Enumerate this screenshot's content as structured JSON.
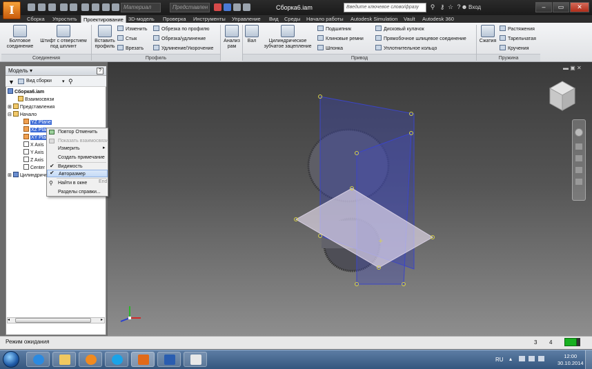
{
  "titlebar": {
    "material_combo": "Материал",
    "view_combo": "Представлен",
    "document_title": "Сборка6.iam",
    "search_placeholder": "Введите ключевое слово/фразу",
    "login_label": "Вход"
  },
  "menu_tabs": [
    {
      "label": "Сборка"
    },
    {
      "label": "Упростить"
    },
    {
      "label": "Проектирование"
    },
    {
      "label": "3D-модель"
    },
    {
      "label": "Проверка"
    },
    {
      "label": "Инструменты"
    },
    {
      "label": "Управление"
    },
    {
      "label": "Вид"
    },
    {
      "label": "Среды"
    },
    {
      "label": "Начало работы"
    },
    {
      "label": "Autodesk Simulation"
    },
    {
      "label": "Vault"
    },
    {
      "label": "Autodesk 360"
    }
  ],
  "ribbon": {
    "panels": {
      "connections": "Соединения",
      "profile": "Профиль",
      "drive": "Привод",
      "spring": "Пружина"
    },
    "bolted_connection": "Болтовое соединение",
    "pin": "Штифт с отверстием под шплинт",
    "insert_profile": "Вставить профиль",
    "change": "Изменить",
    "joint": "Стык",
    "insert": "Врезать",
    "trim_profile": "Обрезка по профилю",
    "trim_extend": "Обрезка/удлинение",
    "lengthen_shorten": "Удлинение/Укорочение",
    "analysis": "Анализ рам",
    "shaft": "Вал",
    "spur_gear": "Цилиндрическое зубчатое зацепление",
    "bearing": "Подшипник",
    "v_belts": "Клиновые ремни",
    "key": "Шпонка",
    "disc_cam": "Дисковый кулачок",
    "spline": "Прямобочное шлицевое соединение",
    "o_ring": "Уплотнительное кольцо",
    "compression": "Сжатия",
    "extension": "Растяжения",
    "belleville": "Тарельчатая",
    "torsion": "Кручения"
  },
  "browser": {
    "title": "Модель",
    "view_label": "Вид сборки",
    "tree": [
      {
        "label": "Сборка6.iam"
      },
      {
        "label": "Взаимосвязи"
      },
      {
        "label": "Представления"
      },
      {
        "label": "Начало"
      },
      {
        "label": "YZ Plane"
      },
      {
        "label": "XZ Plane"
      },
      {
        "label": "XY Plane"
      },
      {
        "label": "X Axis"
      },
      {
        "label": "Y Axis"
      },
      {
        "label": "Z Axis"
      },
      {
        "label": "Center Point"
      },
      {
        "label": "Цилиндрическое зубчатое"
      }
    ]
  },
  "context_menu": {
    "items": [
      {
        "label": "Повтор Отменить"
      },
      {
        "label": "Показать взаимосвязи"
      },
      {
        "label": "Измерить"
      },
      {
        "label": "Создать примечание"
      },
      {
        "label": "Видимость"
      },
      {
        "label": "Авторазмер"
      },
      {
        "label": "Найти в окне"
      },
      {
        "label": "Разделы справки..."
      }
    ],
    "find_shortcut": "End"
  },
  "statusbar": {
    "status": "Режим ожидания",
    "count_a": "3",
    "count_b": "4"
  },
  "taskbar": {
    "language": "RU",
    "time": "12:00",
    "date": "30.10.2014"
  },
  "colors": {
    "ribbon_bg": "#e6e8eb",
    "plane_blue": "#3c46a8",
    "plane_white": "#e8dcef",
    "selection": "#3d6bd6",
    "status_green": "#18b020"
  }
}
